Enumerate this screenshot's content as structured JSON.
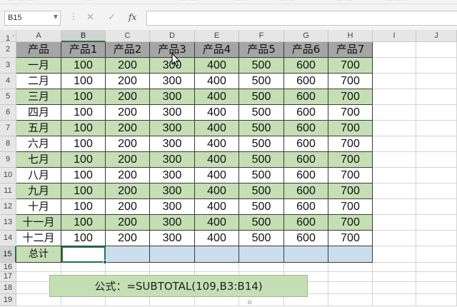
{
  "formula_bar": {
    "name_box": "B15",
    "cancel_glyph": "✕",
    "enter_glyph": "✓",
    "fx_label": "fx",
    "formula_value": ""
  },
  "sheet": {
    "column_letters": [
      "A",
      "B",
      "C",
      "D",
      "E",
      "F",
      "G",
      "H",
      "I",
      "J"
    ],
    "row_numbers": [
      "1",
      "2",
      "3",
      "4",
      "5",
      "6",
      "7",
      "8",
      "9",
      "10",
      "11",
      "12",
      "13",
      "14",
      "15",
      "16",
      "17",
      "18",
      "19"
    ],
    "active_cell": "B15",
    "header_row": [
      "产品",
      "产品1",
      "产品2",
      "产品3",
      "产品4",
      "产品5",
      "产品6",
      "产品7"
    ],
    "rows": [
      {
        "month": "一月",
        "values": [
          "100",
          "200",
          "300",
          "400",
          "500",
          "600",
          "700"
        ]
      },
      {
        "month": "二月",
        "values": [
          "100",
          "200",
          "300",
          "400",
          "500",
          "600",
          "700"
        ]
      },
      {
        "month": "三月",
        "values": [
          "100",
          "200",
          "300",
          "400",
          "500",
          "600",
          "700"
        ]
      },
      {
        "month": "四月",
        "values": [
          "100",
          "200",
          "300",
          "400",
          "500",
          "600",
          "700"
        ]
      },
      {
        "month": "五月",
        "values": [
          "100",
          "200",
          "300",
          "400",
          "500",
          "600",
          "700"
        ]
      },
      {
        "month": "六月",
        "values": [
          "100",
          "200",
          "300",
          "400",
          "500",
          "600",
          "700"
        ]
      },
      {
        "month": "七月",
        "values": [
          "100",
          "200",
          "300",
          "400",
          "500",
          "600",
          "700"
        ]
      },
      {
        "month": "八月",
        "values": [
          "100",
          "200",
          "300",
          "400",
          "500",
          "600",
          "700"
        ]
      },
      {
        "month": "九月",
        "values": [
          "100",
          "200",
          "300",
          "400",
          "500",
          "600",
          "700"
        ]
      },
      {
        "month": "十月",
        "values": [
          "100",
          "200",
          "300",
          "400",
          "500",
          "600",
          "700"
        ]
      },
      {
        "month": "十一月",
        "values": [
          "100",
          "200",
          "300",
          "400",
          "500",
          "600",
          "700"
        ]
      },
      {
        "month": "十二月",
        "values": [
          "100",
          "200",
          "300",
          "400",
          "500",
          "600",
          "700"
        ]
      }
    ],
    "total_label": "总计",
    "total_values": [
      "",
      "",
      "",
      "",
      "",
      "",
      ""
    ]
  },
  "annotation": {
    "formula_text": "公式：=SUBTOTAL(109,B3:B14)"
  },
  "icons": {
    "cursor": "mouse-pointer-icon",
    "name_box_dropdown": "chevron-down-icon",
    "fill_handle": "fill-handle-icon"
  },
  "colors": {
    "header_fill": "#a5a5a5",
    "band_green": "#c5dfb4",
    "total_blue": "#ccdeec",
    "selection_green": "#217346"
  }
}
